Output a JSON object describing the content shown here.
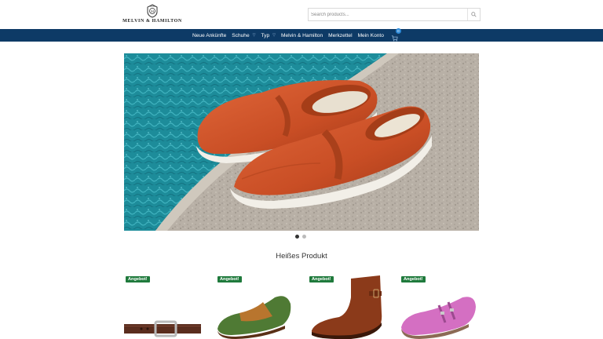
{
  "brand": {
    "name": "MELVIN & HAMILTON",
    "logo_icon": "crest-icon"
  },
  "search": {
    "placeholder": "Search products...",
    "button_icon": "search-icon"
  },
  "nav": {
    "items": [
      {
        "label": "Neue Ankünfte",
        "has_dropdown": false
      },
      {
        "label": "Schuhe",
        "has_dropdown": true
      },
      {
        "label": "Typ",
        "has_dropdown": true
      },
      {
        "label": "Melvin & Hamilton",
        "has_dropdown": false
      },
      {
        "label": "Merkzettel",
        "has_dropdown": false
      },
      {
        "label": "Mein Konto",
        "has_dropdown": false
      }
    ],
    "cart_icon": "cart-icon",
    "cart_count": "0"
  },
  "hero": {
    "slides_total": 2,
    "active_slide": 1
  },
  "hot_products": {
    "title": "Heißes Produkt",
    "items": [
      {
        "badge": "Angebot!"
      },
      {
        "badge": "Angebot!"
      },
      {
        "badge": "Angebot!"
      },
      {
        "badge": "Angebot!"
      }
    ]
  },
  "colors": {
    "nav_bg": "#0d3a66",
    "sale_badge": "#1f7a3c"
  }
}
